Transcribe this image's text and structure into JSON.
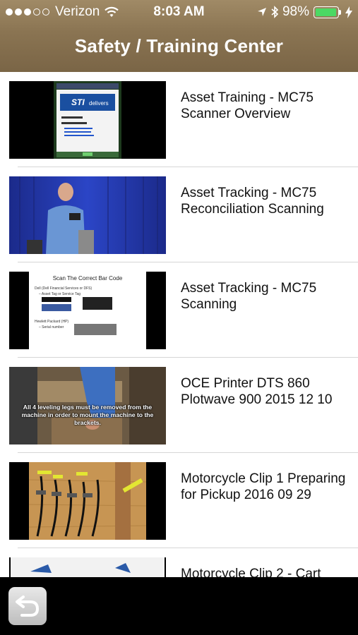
{
  "status_bar": {
    "carrier": "Verizon",
    "time": "8:03 AM",
    "battery": "98%",
    "battery_level": 0.98
  },
  "header": {
    "title": "Safety / Training Center"
  },
  "videos": [
    {
      "title": "Asset Training - MC75 Scanner Overview"
    },
    {
      "title": "Asset Tracking - MC75 Reconciliation Scanning"
    },
    {
      "title": "Asset Tracking - MC75 Scanning"
    },
    {
      "title": "OCE Printer DTS 860 Plotwave 900 2015 12 10"
    },
    {
      "title": "Motorcycle Clip 1 Preparing for Pickup 2016 09 29"
    },
    {
      "title": "Motorcycle Clip 2 - Cart"
    }
  ],
  "thumb_text": {
    "sti": "STI delivers",
    "scan_title": "Scan The Correct Bar Code",
    "scan_line1": "Dell (Dell Financial Services or DFS)",
    "scan_line2": "– Asset Tag or Service Tag",
    "scan_line3": "Hewlett Packard (HP)",
    "scan_line4": "– Serial number",
    "oce_caption": "All 4 leveling legs must be removed from the machine in order to mount the machine to the brackets."
  },
  "colors": {
    "header": "#8a7452",
    "battery": "#4cd964"
  }
}
